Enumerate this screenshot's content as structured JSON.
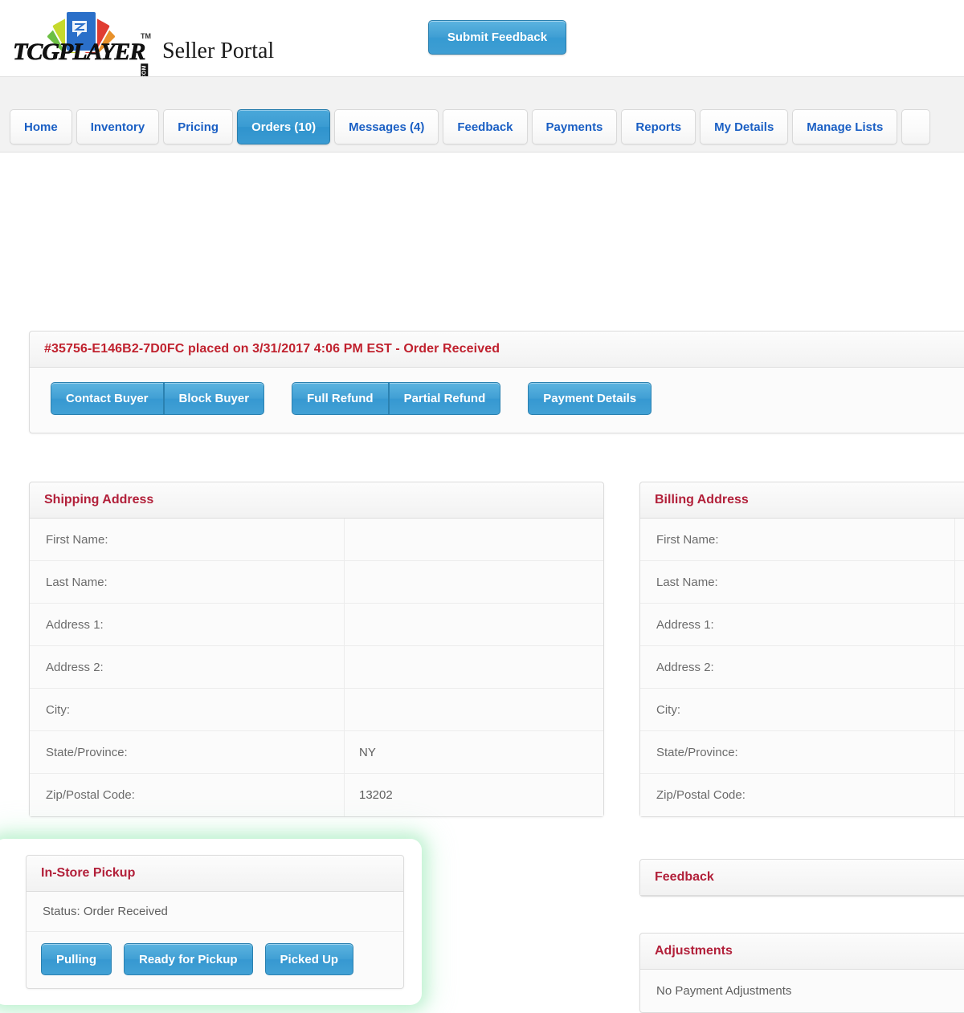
{
  "header": {
    "logo_word": "TCGPLAYER",
    "logo_dotcom": ".COM",
    "logo_tm": "TM",
    "portal_title": "Seller Portal",
    "submit_feedback_label": "Submit Feedback"
  },
  "nav": {
    "tabs": [
      {
        "label": "Home",
        "active": false
      },
      {
        "label": "Inventory",
        "active": false
      },
      {
        "label": "Pricing",
        "active": false
      },
      {
        "label": "Orders (10)",
        "active": true
      },
      {
        "label": "Messages (4)",
        "active": false
      },
      {
        "label": "Feedback",
        "active": false
      },
      {
        "label": "Payments",
        "active": false
      },
      {
        "label": "Reports",
        "active": false
      },
      {
        "label": "My Details",
        "active": false
      },
      {
        "label": "Manage Lists",
        "active": false
      },
      {
        "label": "",
        "active": false
      }
    ]
  },
  "order": {
    "header_text": "#35756-E146B2-7D0FC placed on 3/31/2017 4:06 PM EST  - Order Received",
    "buyer_group": [
      "Contact Buyer",
      "Block Buyer"
    ],
    "refund_group": [
      "Full Refund",
      "Partial Refund"
    ],
    "payment_group": [
      "Payment Details"
    ]
  },
  "shipping_address": {
    "title": "Shipping Address",
    "rows": [
      {
        "label": "First Name:",
        "value": ""
      },
      {
        "label": "Last Name:",
        "value": ""
      },
      {
        "label": "Address 1:",
        "value": ""
      },
      {
        "label": "Address 2:",
        "value": ""
      },
      {
        "label": "City:",
        "value": ""
      },
      {
        "label": "State/Province:",
        "value": "NY"
      },
      {
        "label": "Zip/Postal Code:",
        "value": "13202"
      }
    ]
  },
  "billing_address": {
    "title": "Billing Address",
    "rows": [
      {
        "label": "First Name:",
        "value": ""
      },
      {
        "label": "Last Name:",
        "value": ""
      },
      {
        "label": "Address 1:",
        "value": ""
      },
      {
        "label": "Address 2:",
        "value": ""
      },
      {
        "label": "City:",
        "value": ""
      },
      {
        "label": "State/Province:",
        "value": ""
      },
      {
        "label": "Zip/Postal Code:",
        "value": ""
      }
    ]
  },
  "pickup": {
    "title": "In-Store Pickup",
    "status": "Status: Order Received",
    "buttons": [
      "Pulling",
      "Ready for Pickup",
      "Picked Up"
    ]
  },
  "feedback": {
    "title": "Feedback"
  },
  "adjustments": {
    "title": "Adjustments",
    "body": "No Payment Adjustments"
  },
  "colors": {
    "accent_blue": "#3a9bd2",
    "heading_red": "#b2203a",
    "order_red": "#c0212e",
    "tab_link_blue": "#1a5fc4",
    "highlight_green": "#8ce6aa"
  }
}
